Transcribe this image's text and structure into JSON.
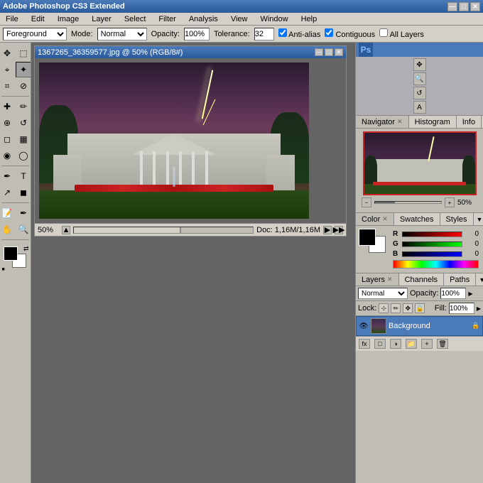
{
  "title_bar": {
    "title": "Adobe Photoshop CS3 Extended",
    "min_label": "—",
    "max_label": "□",
    "close_label": "✕"
  },
  "menu_bar": {
    "items": [
      "File",
      "Edit",
      "Image",
      "Layer",
      "Select",
      "Filter",
      "Analysis",
      "View",
      "Window",
      "Help"
    ]
  },
  "options_bar": {
    "tool_dropdown": "Foreground",
    "mode_label": "Mode:",
    "mode_value": "Normal",
    "opacity_label": "Opacity:",
    "opacity_value": "100%",
    "tolerance_label": "Tolerance:",
    "tolerance_value": "32",
    "anti_alias_label": "Anti-alias",
    "contiguous_label": "Contiguous",
    "all_layers_label": "All Layers"
  },
  "document": {
    "title": "1367265_36359577.jpg @ 50% (RGB/8#)",
    "status": "Doc: 1,16M/1,16M",
    "zoom": "50%"
  },
  "right_panel": {
    "navigator_tab": "Navigator",
    "histogram_tab": "Histogram",
    "info_tab": "Info",
    "zoom_percent": "50%",
    "color_tab": "Color",
    "swatches_tab": "Swatches",
    "styles_tab": "Styles",
    "r_value": "0",
    "g_value": "0",
    "b_value": "0",
    "layers_tab": "Layers",
    "channels_tab": "Channels",
    "paths_tab": "Paths",
    "blend_mode": "Normal",
    "opacity_label": "Opacity:",
    "opacity_value": "100%",
    "lock_label": "Lock:",
    "fill_label": "Fill:",
    "fill_value": "100%",
    "layer_name": "Background"
  },
  "toolbar": {
    "tools": [
      {
        "name": "move",
        "icon": "✥"
      },
      {
        "name": "marquee-rect",
        "icon": "⬚"
      },
      {
        "name": "marquee-lasso",
        "icon": "⌖"
      },
      {
        "name": "magic-wand",
        "icon": "✦"
      },
      {
        "name": "crop",
        "icon": "⌗"
      },
      {
        "name": "slice",
        "icon": "⊘"
      },
      {
        "name": "heal",
        "icon": "✚"
      },
      {
        "name": "brush",
        "icon": "✏"
      },
      {
        "name": "stamp",
        "icon": "⊕"
      },
      {
        "name": "history",
        "icon": "↺"
      },
      {
        "name": "eraser",
        "icon": "◻"
      },
      {
        "name": "gradient",
        "icon": "▦"
      },
      {
        "name": "blur",
        "icon": "◉"
      },
      {
        "name": "dodge",
        "icon": "◯"
      },
      {
        "name": "pen",
        "icon": "🖋"
      },
      {
        "name": "type",
        "icon": "T"
      },
      {
        "name": "path-select",
        "icon": "↗"
      },
      {
        "name": "shape",
        "icon": "◼"
      },
      {
        "name": "notes",
        "icon": "🗒"
      },
      {
        "name": "eyedropper",
        "icon": "✒"
      },
      {
        "name": "hand",
        "icon": "✋"
      },
      {
        "name": "zoom",
        "icon": "🔍"
      }
    ]
  }
}
